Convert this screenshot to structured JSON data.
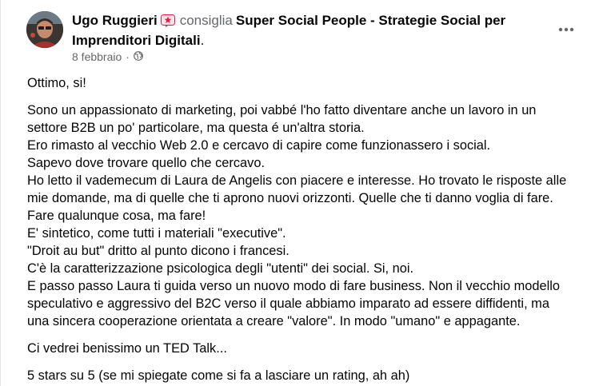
{
  "post": {
    "author": "Ugo Ruggieri",
    "verb": "consiglia",
    "page_name": "Super Social People - Strategie Social per Imprenditori Digitali",
    "page_name_suffix": ".",
    "date": "8 febbraio",
    "separator": "·",
    "icons": {
      "avatar": "profile-photo",
      "badge": "star-badge-icon",
      "privacy": "globe-icon",
      "menu": "more-options-icon"
    },
    "colors": {
      "secondary_text": "#65676b",
      "badge": "#e41e3f"
    },
    "body": {
      "intro": "Ottimo, si!",
      "paragraph_lines": [
        "Sono un appassionato di marketing, poi vabbé l'ho fatto diventare anche un lavoro in un",
        "settore B2B un po' particolare, ma questa é un'altra storia.",
        "Ero rimasto al vecchio Web 2.0 e cercavo di capire come funzionassero i social.",
        "Sapevo dove trovare quello che cercavo.",
        "Ho letto il vademecum di Laura de Angelis con piacere e interesse. Ho trovato le risposte alle",
        "mie domande, ma di quelle che ti aprono nuovi orizzonti. Quelle che ti danno voglia di fare.",
        "Fare qualunque cosa, ma fare!",
        "E' sintetico, come tutti i materiali \"executive\".",
        "\"Droit au but\" dritto al punto dicono i francesi.",
        "C'è la caratterizzazione psicologica degli \"utenti\" dei social. Si, noi.",
        "E passo passo Laura ti guida verso un nuovo modo di fare business. Non il vecchio modello",
        "speculativo e aggressivo del B2C verso il quale abbiamo imparato ad essere diffidenti, ma",
        "una sincera cooperazione orientata a creare \"valore\". In modo \"umano\" e appagante."
      ],
      "ted_line": "Ci vedrei benissimo un TED Talk...",
      "rating_line": "5 stars su 5 (se mi spiegate come si fa a lasciare un rating, ah ah)"
    }
  }
}
